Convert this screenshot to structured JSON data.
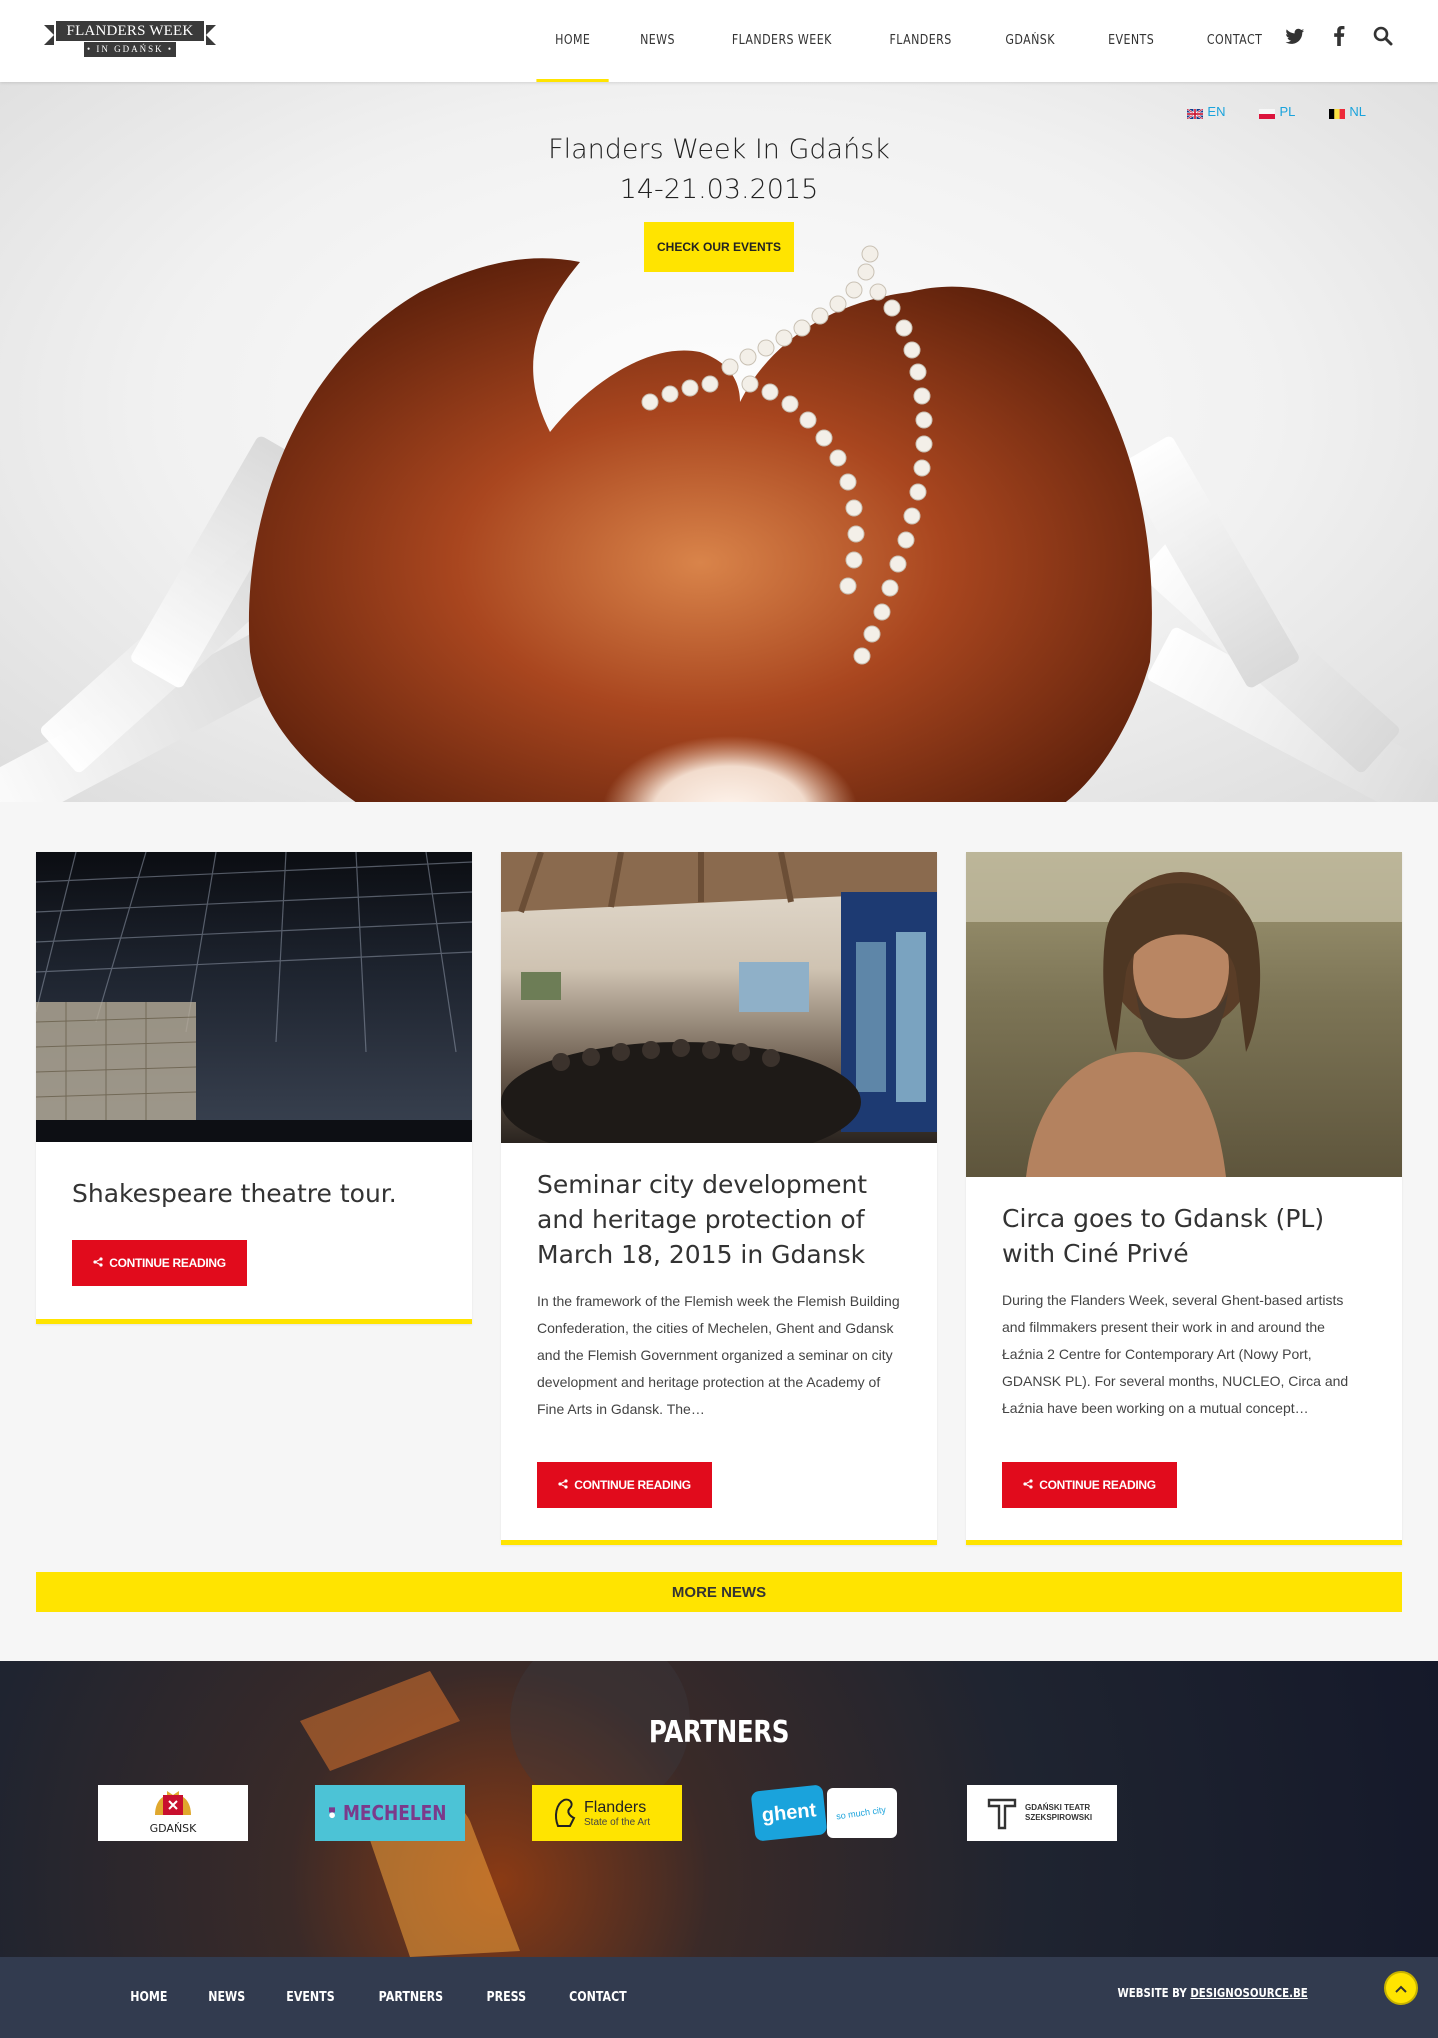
{
  "header": {
    "logo_top": "FLANDERS WEEK",
    "logo_bottom": "• IN GDAŃSK •",
    "nav": [
      "HOME",
      "NEWS",
      "FLANDERS WEEK",
      "FLANDERS",
      "GDAŃSK",
      "EVENTS",
      "CONTACT"
    ],
    "active_nav": "HOME",
    "social_icons": [
      "twitter-icon",
      "facebook-icon",
      "search-icon"
    ]
  },
  "hero": {
    "languages": [
      {
        "code": "EN",
        "flag": "uk-flag-icon"
      },
      {
        "code": "PL",
        "flag": "poland-flag-icon"
      },
      {
        "code": "NL",
        "flag": "belgium-flag-icon"
      }
    ],
    "title": "Flanders Week In Gdańsk",
    "dates": "14-21.03.2015",
    "cta": "CHECK OUR EVENTS"
  },
  "news": [
    {
      "title": "Shakespeare theatre tour.",
      "excerpt": "",
      "button": "CONTINUE READING"
    },
    {
      "title": "Seminar city development and heritage protection of March 18, 2015 in Gdansk",
      "excerpt": "In the framework of the Flemish week the Flemish Building Confederation, the cities of Mechelen, Ghent and Gdansk and the Flemish Government organized a seminar on city development and heritage protection at the Academy of Fine Arts in Gdansk. The…",
      "button": "CONTINUE READING"
    },
    {
      "title": "Circa goes to Gdansk (PL) with Ciné Privé",
      "excerpt": "During the Flanders Week, several Ghent-based artists and filmmakers present their work in and around the Łaźnia 2 Centre for Contemporary Art (Nowy Port, GDANSK PL). For several months, NUCLEO, Circa and Łaźnia have been working on a mutual concept…",
      "button": "CONTINUE READING"
    }
  ],
  "more_news": "MORE NEWS",
  "partners": {
    "heading": "PARTNERS",
    "logos": [
      {
        "name": "GDAŃSK"
      },
      {
        "name": "MECHELEN"
      },
      {
        "name": "Flanders",
        "tagline": "State of the Art"
      },
      {
        "name": "ghent",
        "tagline": "so much city"
      },
      {
        "name": "GDAŃSKI TEATR SZEKSPIROWSKI"
      }
    ]
  },
  "footer": {
    "nav": [
      "HOME",
      "NEWS",
      "EVENTS",
      "PARTNERS",
      "PRESS",
      "CONTACT"
    ],
    "credit_prefix": "WEBSITE BY",
    "credit_link": "DESIGNOSOURCE.BE"
  },
  "colors": {
    "accent": "#ffe400",
    "button_red": "#e10b1c",
    "footer_bg": "#323b4f",
    "lang_link": "#1aa3dc"
  }
}
